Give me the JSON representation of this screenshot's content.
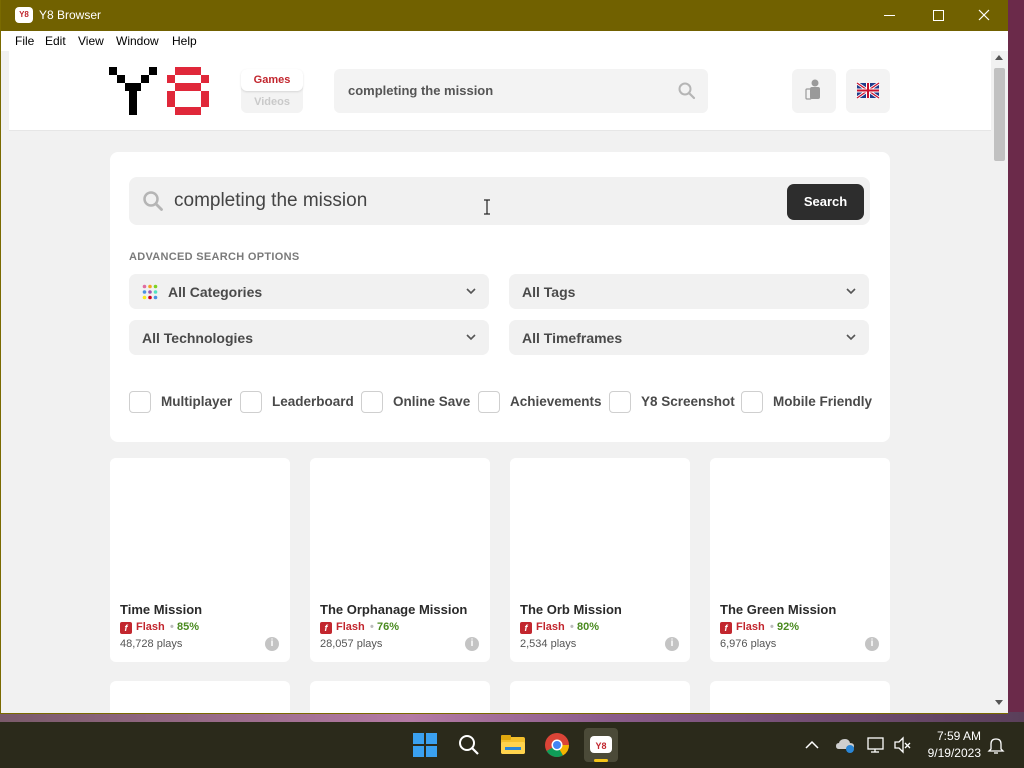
{
  "window": {
    "title": "Y8 Browser",
    "app_icon_text": "Y8",
    "controls": [
      "minimize",
      "maximize",
      "close"
    ]
  },
  "menu": [
    "File",
    "Edit",
    "View",
    "Window",
    "Help"
  ],
  "header": {
    "nav_games": "Games",
    "nav_videos": "Videos",
    "search_value": "completing the mission"
  },
  "search": {
    "query": "completing the mission",
    "button": "Search",
    "advanced_label": "ADVANCED SEARCH OPTIONS",
    "selects": {
      "categories": "All Categories",
      "tags": "All Tags",
      "technologies": "All Technologies",
      "timeframes": "All Timeframes"
    },
    "filters": [
      "Multiplayer",
      "Leaderboard",
      "Online Save",
      "Achievements",
      "Y8 Screenshot",
      "Mobile Friendly"
    ]
  },
  "results": [
    {
      "title": "Time Mission",
      "tech": "Flash",
      "rating": "85%",
      "plays": "48,728 plays"
    },
    {
      "title": "The Orphanage Mission",
      "tech": "Flash",
      "rating": "76%",
      "plays": "28,057 plays"
    },
    {
      "title": "The Orb Mission",
      "tech": "Flash",
      "rating": "80%",
      "plays": "2,534 plays"
    },
    {
      "title": "The Green Mission",
      "tech": "Flash",
      "rating": "92%",
      "plays": "6,976 plays"
    }
  ],
  "taskbar": {
    "apps": [
      "start-icon",
      "search-icon",
      "file-explorer-icon",
      "chrome-icon",
      "y8-browser-icon"
    ],
    "time": "7:59 AM",
    "date": "9/19/2023"
  },
  "colors": {
    "titlebar": "#716100",
    "brand_red": "#c2262e",
    "rating_green": "#4a8a1f",
    "search_button": "#2d2d2d",
    "taskbar": "#2b2a1b"
  }
}
